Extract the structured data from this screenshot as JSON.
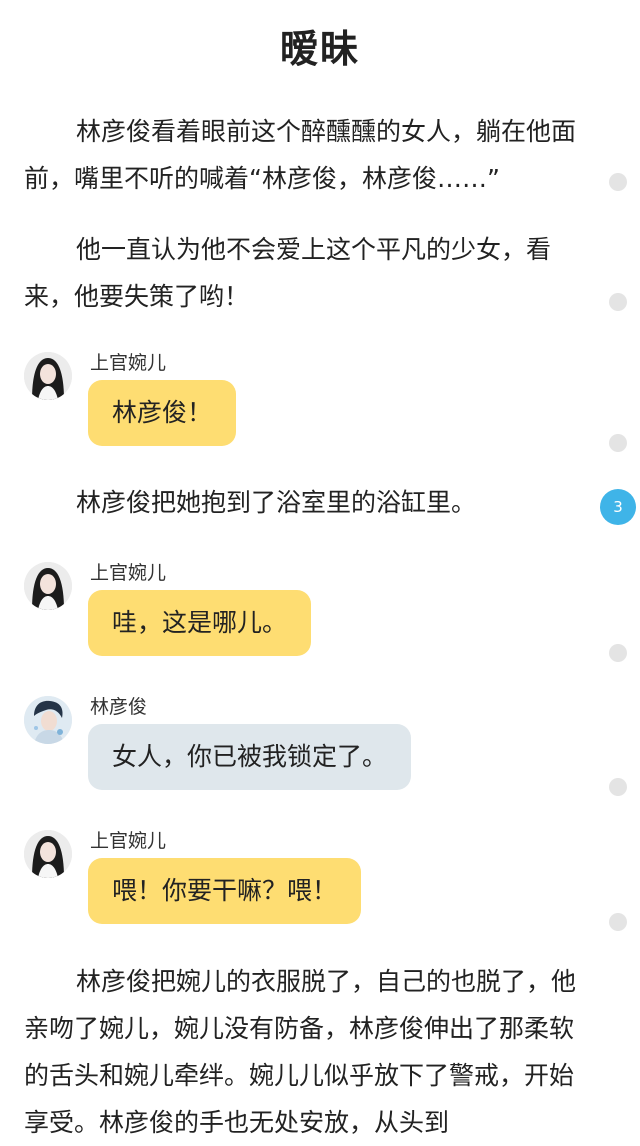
{
  "title": "暧昧",
  "paragraphs": [
    "林彦俊看着眼前这个醉醺醺的女人，躺在他面前，嘴里不听的喊着“林彦俊，林彦俊……”",
    "他一直认为他不会爱上这个平凡的少女，看来，他要失策了哟！",
    "林彦俊把她抱到了浴室里的浴缸里。",
    "林彦俊把婉儿的衣服脱了，自己的也脱了，他亲吻了婉儿，婉儿没有防备，林彦俊伸出了那柔软的舌头和婉儿牵绊。婉儿儿似乎放下了警戒，开始享受。林彦俊的手也无处安放，从头到"
  ],
  "messages": [
    {
      "speaker": "上官婉儿",
      "text": "林彦俊！",
      "bubble_color": "#fedd72",
      "avatar": "female-avatar"
    },
    {
      "speaker": "上官婉儿",
      "text": "哇，这是哪儿。",
      "bubble_color": "#fedd72",
      "avatar": "female-avatar"
    },
    {
      "speaker": "林彦俊",
      "text": "女人，你已被我锁定了。",
      "bubble_color": "#dfe7ec",
      "avatar": "male-avatar"
    },
    {
      "speaker": "上官婉儿",
      "text": "喂！你要干嘛？喂！",
      "bubble_color": "#fedd72",
      "avatar": "female-avatar"
    }
  ],
  "comment_badge": "3",
  "colors": {
    "accent": "#3fb4e8",
    "bubble_yellow": "#fedd72",
    "bubble_blue": "#dfe7ec"
  }
}
